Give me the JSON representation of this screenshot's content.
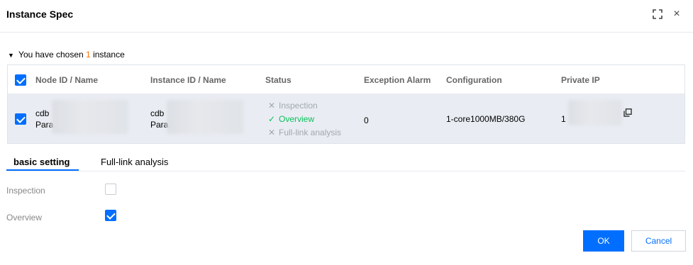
{
  "dialog": {
    "title": "Instance Spec",
    "fullscreen_icon": "fullscreen-icon",
    "close_glyph": "×"
  },
  "summary": {
    "prefix": "You have chosen",
    "count": "1",
    "suffix": "instance",
    "toggle_glyph": "▼"
  },
  "table": {
    "headers": {
      "node": "Node ID / Name",
      "instance": "Instance ID / Name",
      "status": "Status",
      "alarm": "Exception Alarm",
      "config": "Configuration",
      "ip": "Private IP"
    },
    "header_checked": true,
    "row": {
      "checked": true,
      "node_id": "cdb",
      "node_name": "Para",
      "instance_id": "cdb",
      "instance_name": "Para",
      "status": {
        "inspection": "Inspection",
        "inspection_state": "off",
        "overview": "Overview",
        "overview_state": "on",
        "full_link": "Full-link analysis",
        "full_link_state": "off"
      },
      "alarm": "0",
      "config": "1-core1000MB/380G",
      "ip_prefix": "1",
      "copy_icon": "copy-icon"
    }
  },
  "tabs": [
    {
      "label": "basic setting",
      "active": true
    },
    {
      "label": "Full-link analysis",
      "active": false
    }
  ],
  "form": {
    "inspection_label": "Inspection",
    "inspection_checked": false,
    "overview_label": "Overview",
    "overview_checked": true
  },
  "buttons": {
    "ok": "OK",
    "cancel": "Cancel"
  },
  "colors": {
    "primary": "#006eff",
    "success": "#0abf5b",
    "count_highlight": "#ff7200",
    "muted": "#a2a7af"
  }
}
